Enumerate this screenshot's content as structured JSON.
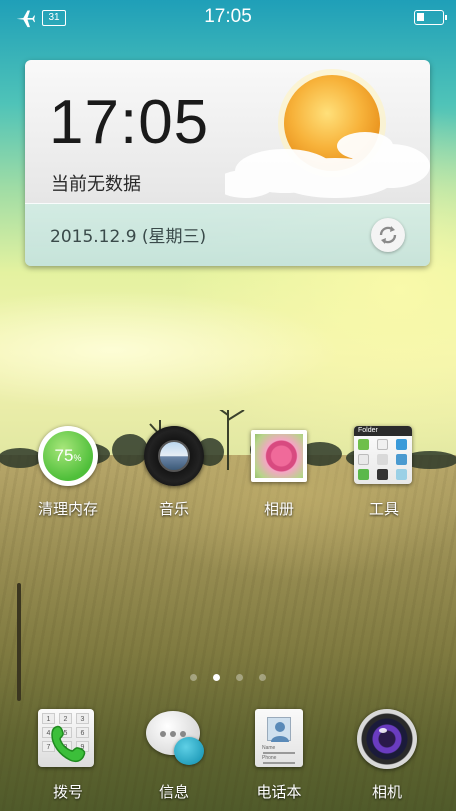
{
  "status_bar": {
    "time": "17:05",
    "calendar_day": "31",
    "icons": [
      "airplane-icon",
      "calendar-icon",
      "battery-icon"
    ]
  },
  "widget": {
    "time": "17:05",
    "weather_text": "当前无数据",
    "date": "2015.12.9 (星期三)",
    "weather_icon": "sun-cloud-icon",
    "refresh_icon": "refresh-icon"
  },
  "home_apps": [
    {
      "label": "清理内存",
      "percent": "75",
      "percent_unit": "%"
    },
    {
      "label": "音乐"
    },
    {
      "label": "相册"
    },
    {
      "label": "工具",
      "folder_title": "Folder"
    }
  ],
  "page_indicator": {
    "count": 4,
    "active_index": 1
  },
  "dock": [
    {
      "label": "拨号"
    },
    {
      "label": "信息"
    },
    {
      "label": "电话本"
    },
    {
      "label": "相机"
    }
  ],
  "dialer_keys": [
    "1",
    "2",
    "3",
    "4",
    "5",
    "6",
    "7",
    "8",
    "9"
  ],
  "contacts_fields": [
    "Name",
    "Phone"
  ],
  "colors": {
    "accent_green": "#4fbf3a",
    "sky_teal": "#1f9fb8",
    "sun_orange": "#f5a623",
    "message_blue": "#1e9ab8",
    "camera_purple": "#6a3cc0"
  }
}
